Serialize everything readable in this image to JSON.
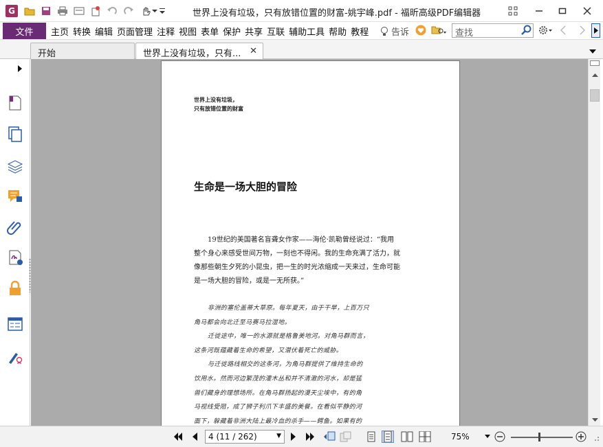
{
  "titlebar": {
    "title": "世界上没有垃圾，只有放错位置的财富-姚宇峰.pdf - 福昕高级PDF编辑器",
    "logo_letter": "G",
    "quick_access_icons": [
      "open-folder-icon",
      "save-icon",
      "print-icon",
      "new-doc-icon",
      "stamp-icon",
      "undo-icon",
      "redo-icon",
      "hand-icon",
      "customize-icon"
    ],
    "window_controls": [
      "restore-layout-icon",
      "minimize-icon",
      "maximize-icon",
      "close-icon"
    ]
  },
  "menubar": {
    "file_label": "文件",
    "items": [
      "主页",
      "转换",
      "编辑",
      "页面管理",
      "注释",
      "视图",
      "表单",
      "保护",
      "共享",
      "互联",
      "辅助工具",
      "帮助",
      "教程"
    ],
    "tell_me_label": "告诉",
    "search_placeholder": "查找"
  },
  "tabs": [
    {
      "label": "开始",
      "active": false
    },
    {
      "label": "世界上没有垃圾，只有...",
      "active": true
    }
  ],
  "sidebar": {
    "icons": [
      "page-thumbnail-icon",
      "pages-icon",
      "layers-icon",
      "comments-icon",
      "attachments-icon",
      "signature-icon",
      "security-lock-icon",
      "form-fields-icon",
      "certify-icon"
    ]
  },
  "document": {
    "header_lines": [
      "世界上没有垃圾，",
      "只有放错位置的财富"
    ],
    "chapter_title": "生命是一场大胆的冒险",
    "quote_lines": [
      "19世纪的美国著名盲聋女作家——海伦·凯勒曾经说过：“我用",
      "整个身心来感受世间万物，一刻也不得闲。我的生命充满了活力，就",
      "像那些朝生夕死的小昆虫，把一生的时光浓缩成一天来过，生命可能",
      "是一场大胆的冒险，或是一无所获。”"
    ],
    "italic_lines": [
      {
        "text": "非洲的塞伦盖蒂大草原。每年夏天，由于干旱，上百万只",
        "outdent": false
      },
      {
        "text": "角马都会向北迁至马赛马拉湿地。",
        "outdent": true
      },
      {
        "text": "迁徙途中，唯一的水源就是格鲁美地河。对角马群而言，",
        "outdent": false
      },
      {
        "text": "这条河既蕴藏着生命的希望，又潜伏着死亡的威胁。",
        "outdent": true
      },
      {
        "text": "与迁徙路线相交的这条河，为角马群提供了维持生命的",
        "outdent": false
      },
      {
        "text": "饮用水。然而河边繁茂的灌木丛和并不清澈的河水，却是猛",
        "outdent": true
      },
      {
        "text": "兽们藏身的理想场所。在角马群扬起的漫天尘埃中，有的角",
        "outdent": true
      },
      {
        "text": "马视线受阻，成了狮子利爪下丰盛的美餐。在看似平静的河",
        "outdent": true
      },
      {
        "text": "面下，躲藏着非洲大陆上最冷血的杀手——鳄鱼。如果有的",
        "outdent": true
      }
    ]
  },
  "statusbar": {
    "page_value": "4 (11 / 262)",
    "zoom_value": "75%",
    "zoom_fraction": 0.46
  },
  "colors": {
    "accent": "#6b2a76",
    "doc_background": "#ababab"
  }
}
